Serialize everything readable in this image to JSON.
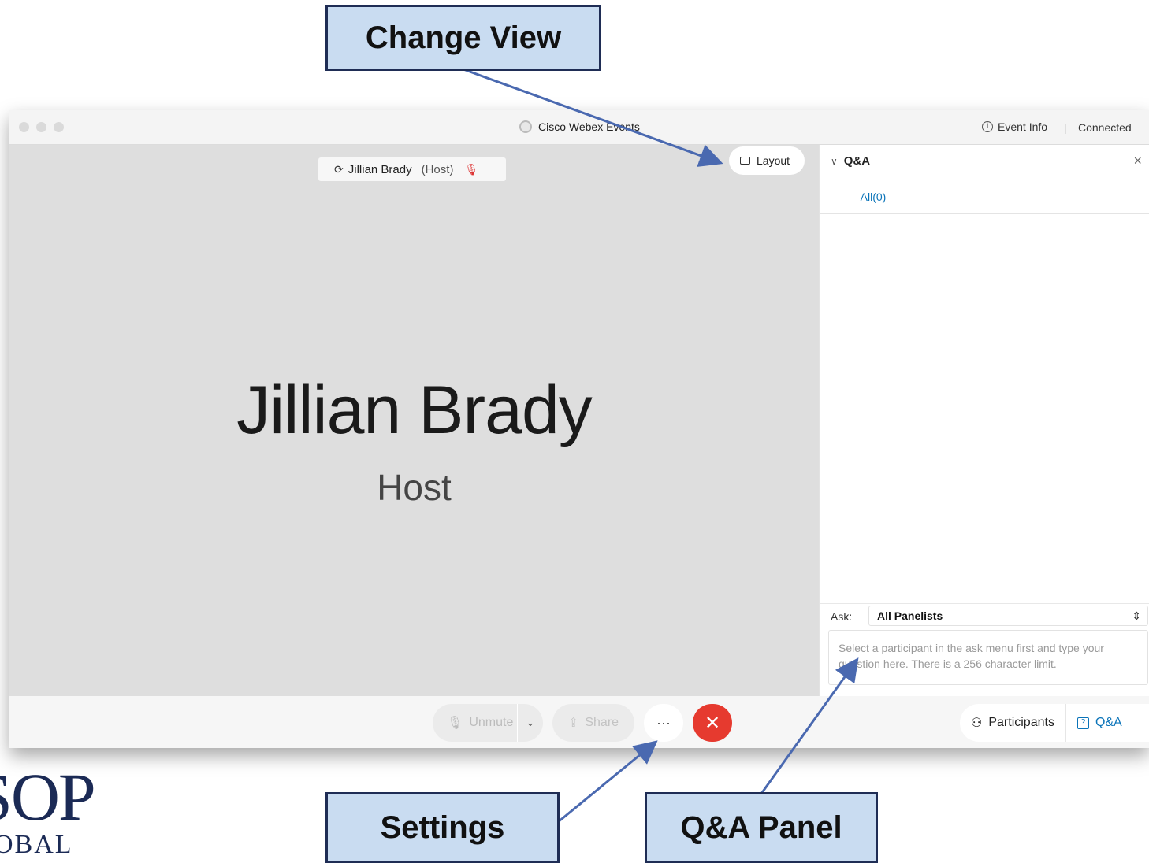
{
  "window": {
    "title": "Cisco Webex Events",
    "event_info_label": "Event Info",
    "separator": "|",
    "status": "Connected"
  },
  "stage": {
    "pill_name": "Jillian Brady",
    "pill_role": "(Host)",
    "layout_label": "Layout",
    "big_name": "Jillian Brady",
    "role_label": "Host"
  },
  "controls": {
    "unmute_label": "Unmute",
    "share_label": "Share",
    "more_label": "···",
    "leave_label": "✕",
    "participants_label": "Participants",
    "qa_label": "Q&A"
  },
  "qa_panel": {
    "title": "Q&A",
    "tab_all": "All(0)",
    "ask_label": "Ask:",
    "ask_selected": "All Panelists",
    "input_placeholder": "Select a participant in the ask menu first and type your question here. There is a 256 character limit."
  },
  "callouts": {
    "change_view": "Change View",
    "settings": "Settings",
    "qa_panel": "Q&A Panel"
  },
  "logo": {
    "line1": "SOP",
    "line2": "OBAL"
  },
  "colors": {
    "accent": "#0b74b9",
    "leave": "#e63a2f",
    "callout_fill": "#c9dcf1",
    "callout_border": "#1f2d55",
    "arrow": "#4a69b0"
  },
  "icons": {
    "person_outline": "participants-icon",
    "qa_box": "qa-icon",
    "mic_slash": "mic-muted-icon",
    "layout_square": "layout-icon",
    "info_circle": "info-icon"
  }
}
